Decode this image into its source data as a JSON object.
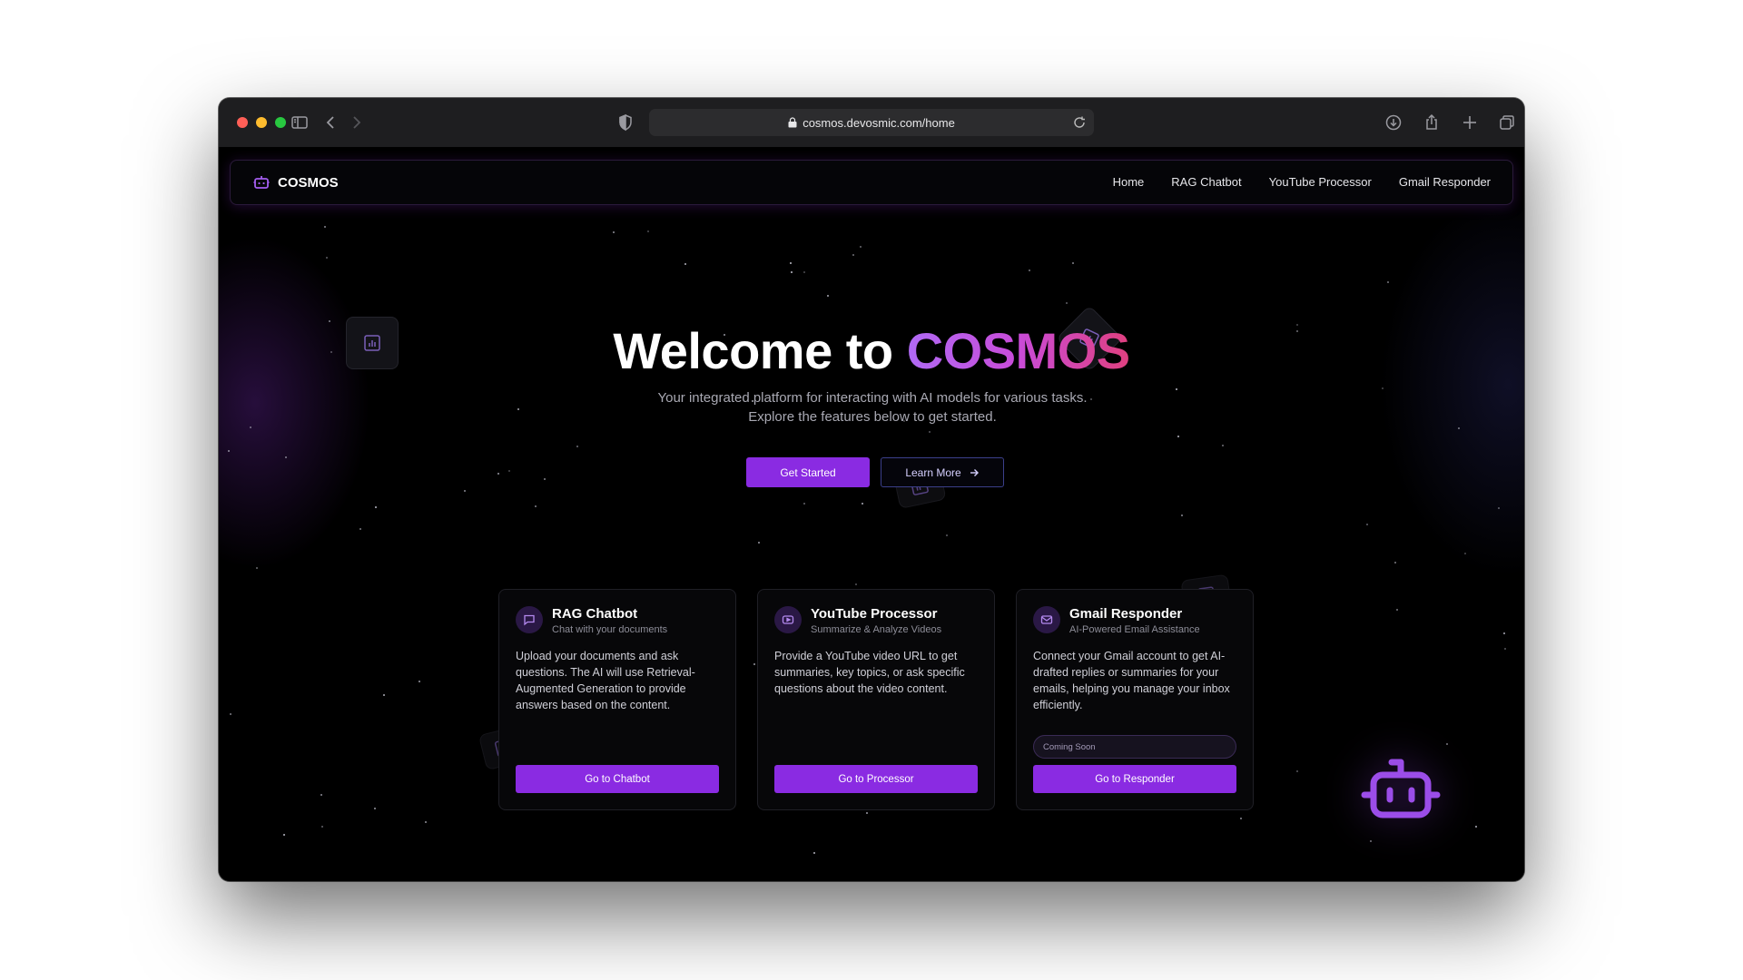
{
  "browser": {
    "url": "cosmos.devosmic.com/home"
  },
  "navbar": {
    "brand": "COSMOS",
    "links": [
      "Home",
      "RAG Chatbot",
      "YouTube Processor",
      "Gmail Responder"
    ]
  },
  "hero": {
    "title_prefix": "Welcome to ",
    "title_accent": "COSMOS",
    "subtitle": "Your integrated platform for interacting with AI models for various tasks. Explore the features below to get started.",
    "primary_button": "Get Started",
    "secondary_button": "Learn More"
  },
  "cards": [
    {
      "title": "RAG Chatbot",
      "subtitle": "Chat with your documents",
      "description": "Upload your documents and ask questions. The AI will use Retrieval-Augmented Generation to provide answers based on the content.",
      "button": "Go to Chatbot",
      "icon": "chat-bubble-icon"
    },
    {
      "title": "YouTube Processor",
      "subtitle": "Summarize & Analyze Videos",
      "description": "Provide a YouTube video URL to get summaries, key topics, or ask specific questions about the video content.",
      "button": "Go to Processor",
      "icon": "video-play-icon"
    },
    {
      "title": "Gmail Responder",
      "subtitle": "AI-Powered Email Assistance",
      "description": "Connect your Gmail account to get AI-drafted replies or summaries for your emails, helping you manage your inbox efficiently.",
      "badge": "Coming Soon",
      "button": "Go to Responder",
      "icon": "mail-icon"
    }
  ],
  "colors": {
    "accent": "#8a2be2",
    "background": "#000000",
    "gradient_start": "#b06af5",
    "gradient_end": "#e0407f"
  }
}
